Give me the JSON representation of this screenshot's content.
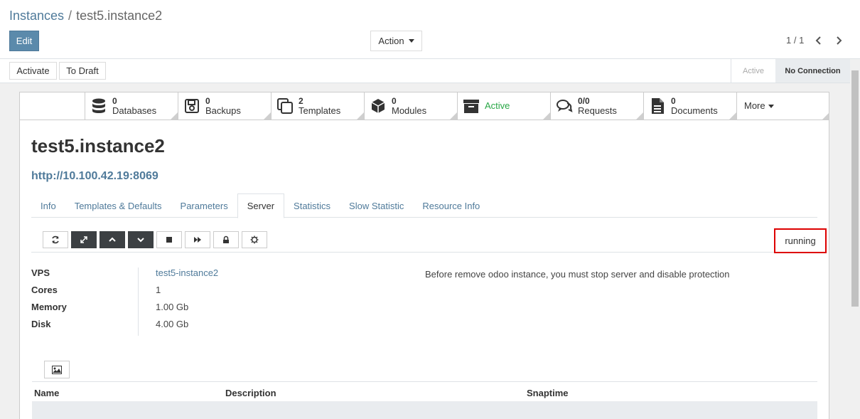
{
  "breadcrumb": {
    "parent": "Instances",
    "separator": "/",
    "current": "test5.instance2"
  },
  "control_panel": {
    "edit_label": "Edit",
    "action_label": "Action",
    "pager_value": "1 / 1"
  },
  "statusbar": {
    "buttons": [
      "Activate",
      "To Draft"
    ],
    "stages": [
      "Active",
      "No Connection"
    ]
  },
  "smart_buttons": [
    {
      "count": "0",
      "label": "Databases",
      "icon": "database-icon"
    },
    {
      "count": "0",
      "label": "Backups",
      "icon": "floppy-icon"
    },
    {
      "count": "2",
      "label": "Templates",
      "icon": "copy-icon"
    },
    {
      "count": "0",
      "label": "Modules",
      "icon": "cube-icon"
    },
    {
      "count": "",
      "label": "Active",
      "icon": "archive-icon",
      "color": "#28a745"
    },
    {
      "count": "0/0",
      "label": "Requests",
      "icon": "comments-icon"
    },
    {
      "count": "0",
      "label": "Documents",
      "icon": "file-icon"
    },
    {
      "count": "",
      "label": "More",
      "icon": "caret-down-icon"
    }
  ],
  "record": {
    "title": "test5.instance2",
    "url": "http://10.100.42.19:8069"
  },
  "tabs": [
    "Info",
    "Templates & Defaults",
    "Parameters",
    "Server",
    "Statistics",
    "Slow Statistic",
    "Resource Info"
  ],
  "active_tab": "Server",
  "server": {
    "state": "running",
    "fields": [
      {
        "label": "VPS",
        "value": "test5-instance2"
      },
      {
        "label": "Cores",
        "value": "1"
      },
      {
        "label": "Memory",
        "value": "1.00 Gb"
      },
      {
        "label": "Disk",
        "value": "4.00 Gb"
      }
    ],
    "note": "Before remove odoo instance, you must stop server and disable protection"
  },
  "snapshots_table": {
    "columns": [
      "Name",
      "Description",
      "Snaptime"
    ]
  },
  "colors": {
    "link": "#4f7a9a",
    "primary": "#5b8aab",
    "success": "#28a745",
    "highlight": "#dd0000"
  }
}
